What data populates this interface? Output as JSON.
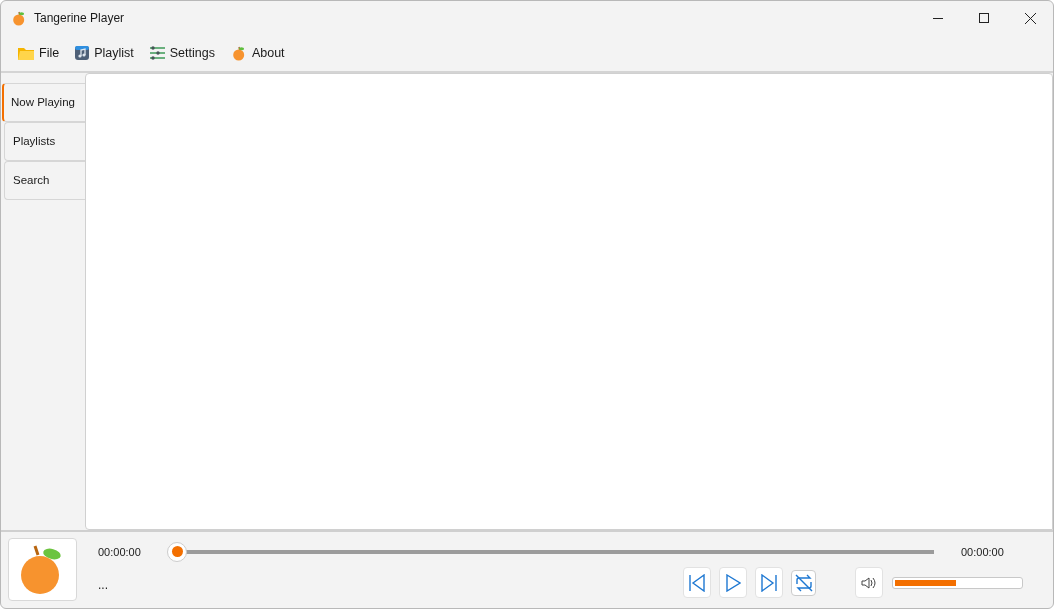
{
  "window": {
    "title": "Tangerine Player"
  },
  "menu": [
    {
      "label": "File",
      "kind": "folder"
    },
    {
      "label": "Playlist",
      "kind": "music"
    },
    {
      "label": "Settings",
      "kind": "sliders"
    },
    {
      "label": "About",
      "kind": "tangerine"
    }
  ],
  "tabs": [
    {
      "label": "Now Playing",
      "selected": true
    },
    {
      "label": "Playlists",
      "selected": false
    },
    {
      "label": "Search",
      "selected": false
    }
  ],
  "player": {
    "elapsed": "00:00:00",
    "duration": "00:00:00",
    "seek": {
      "level": 0
    },
    "track_title": "...",
    "repeat": {
      "on": false
    },
    "volume": {
      "level": 0.49
    }
  }
}
